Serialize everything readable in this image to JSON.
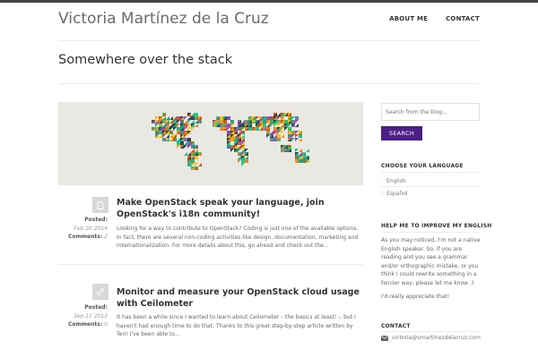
{
  "site": {
    "title": "Victoria Martínez de la Cruz",
    "tagline": "Somewhere over the stack"
  },
  "nav": {
    "items": [
      "ABOUT ME",
      "CONTACT"
    ]
  },
  "posts": [
    {
      "title": "Make OpenStack speak your language, join OpenStack's i18n community!",
      "posted_label": "Posted:",
      "date": "Feb 20 2014",
      "comments_label": "Comments:",
      "comments": "2",
      "excerpt": "Looking for a way to contribute to OpenStack? Coding is just one of the available options. In fact, there are several non-coding activities like design, documentation, marketing and internationalization. For more details about this, go ahead and check out the…",
      "icon": "document-icon"
    },
    {
      "title": "Monitor and measure your OpenStack cloud usage with Ceilometer",
      "posted_label": "Posted:",
      "date": "Sep 11 2013",
      "comments_label": "Comments:",
      "comments": "0",
      "excerpt": "It has been a while since I wanted to learn about Ceilometer – the basics at least! -, but I haven't had enough time to do that. Thanks to this great step-by-step article written by Terri I've been able to…",
      "icon": "link-icon"
    }
  ],
  "sidebar": {
    "search": {
      "placeholder": "Search from the blog…",
      "button": "SEARCH"
    },
    "language": {
      "heading": "CHOOSE YOUR LANGUAGE",
      "options": [
        "English",
        "Español"
      ]
    },
    "english": {
      "heading": "HELP ME TO IMPROVE MY ENGLISH",
      "text": "As you may noticed, I'm not a native English speaker. So, if you are reading and you see a grammar and/or orthographic mistake, or you think I could rewrite something in a fancier way, please let me know :)",
      "thanks": "I'd really appreciate that!"
    },
    "contact": {
      "heading": "CONTACT",
      "email": "victoria@vmartinezdelacruz.com",
      "icon": "envelope-icon"
    }
  },
  "colors": {
    "accent": "#4b1f87",
    "topbar": "#444444",
    "banner_bg": "#e9e8e3"
  }
}
